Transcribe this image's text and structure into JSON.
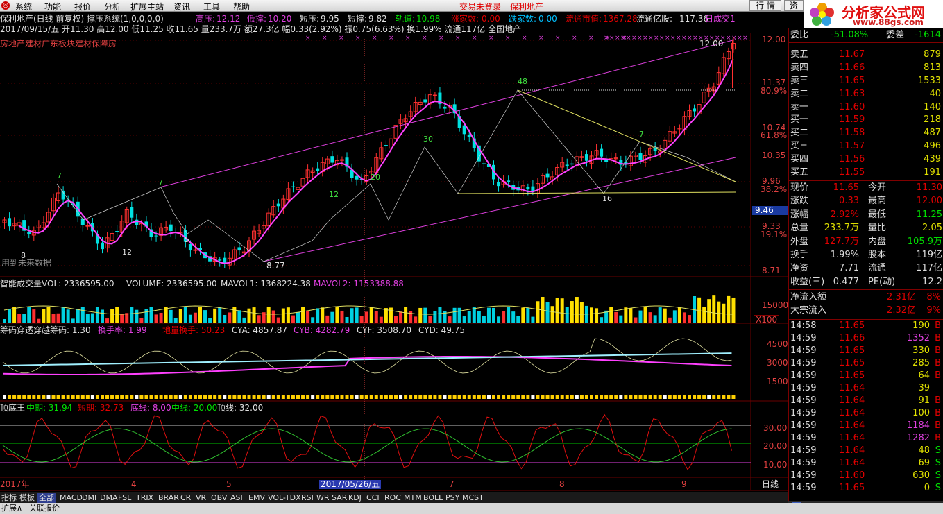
{
  "menu": {
    "items": [
      "系统",
      "功能",
      "报价",
      "分析",
      "扩展主站",
      "资讯",
      "工具",
      "帮助"
    ],
    "center_text": "交易未登录",
    "stock_name": "保利地产",
    "btn_trade": "行 情",
    "btn_news": "资"
  },
  "brand": {
    "title": "分析家公式网",
    "url": "www.88gs.com"
  },
  "header": {
    "line1_title": "保利地产(日线 前复权) 撑压系统(1,0,0,0,0)",
    "gaoya_label": "高压:",
    "gaoya": "12.12",
    "diya_label": "低撑:",
    "diya": "10.20",
    "duanya_label": "短压:",
    "duanya": "9.95",
    "duancheng_label": "短撑:",
    "duancheng": "9.82",
    "guidao_label": "轨道:",
    "guidao": "10.98",
    "zhang_label": "涨家数:",
    "zhang": "0.00",
    "die_label": "跌家数:",
    "die": "0.00",
    "ltsz_label": "流通市值:",
    "ltsz": "1367.28",
    "ltyg_label": "流通亿股:",
    "ltyg": "117.36",
    "rcj": "日成交1",
    "line2": "2017/09/15/五 开11.30 高12.00 低11.25 收11.65 量233.7万 额27.3亿 幅0.33(2.92%) 振0.75(6.63%) 换1.99% 流通117亿 全国地产",
    "line3": "房地产建材广东板块建材保障房",
    "future_note": "用到未来数据"
  },
  "price_axis": [
    "12.00",
    "11.37",
    "80.9%",
    "10.74",
    "61.8%",
    "10.35",
    "9.96",
    "38.2%",
    "9.46",
    "9.33",
    "19.1%",
    "8.71"
  ],
  "price_labels": {
    "top": "12.00",
    "low": "8.77",
    "peaks": [
      "7",
      "7",
      "12",
      "20",
      "30",
      "48",
      "7",
      "8",
      "12",
      "5",
      "16"
    ]
  },
  "volume": {
    "title": "智能成交量",
    "vol": "VOL: 2336595.00",
    "volume": "VOLUME: 2336595.00",
    "mavol1": "MAVOL1: 1368224.38",
    "mavol2": "MAVOL2: 1153388.88",
    "axis": [
      "15000",
      "X100"
    ]
  },
  "chip": {
    "title": "筹码穿透",
    "p1": "穿越筹码: 1.30",
    "p2": "换手率: 1.99",
    "p3": "地量换手: 50.23",
    "cya": "CYA: 4857.87",
    "cyb": "CYB: 4282.79",
    "cyf": "CYF: 3508.70",
    "cyd": "CYD: 49.75",
    "axis": [
      "4500",
      "3000",
      "1500"
    ]
  },
  "bottom": {
    "title": "顶底王",
    "mid": "中期: 31.94",
    "short": "短期: 32.73",
    "base": "底线: 8.00",
    "center": "中线: 20.00",
    "top": "顶线: 32.00",
    "axis": [
      "30.00",
      "20.00",
      "10.00"
    ]
  },
  "dates": [
    "2017年",
    "4",
    "5",
    "2017/05/26/五",
    "7",
    "8",
    "9",
    "日线"
  ],
  "tabs": [
    "指标",
    "模板",
    "全部",
    "MACD",
    "DMI",
    "DMA",
    "FSL",
    "TRIX",
    "BRAR",
    "CR",
    "VR",
    "OBV",
    "ASI",
    "EMV",
    "VOL-TDX",
    "RSI",
    "WR",
    "SAR",
    "KDJ",
    "CCI",
    "ROC",
    "MTM",
    "BOLL",
    "PSY",
    "MCST"
  ],
  "status": [
    "扩展∧",
    "关联报价"
  ],
  "quote": {
    "code_row": "600048 保利地产",
    "weibi_label": "委比",
    "weibi": "-51.08%",
    "weicha_label": "委差",
    "weicha": "-1614",
    "asks": [
      [
        "卖五",
        "11.67",
        "879"
      ],
      [
        "卖四",
        "11.66",
        "813"
      ],
      [
        "卖三",
        "11.65",
        "1533"
      ],
      [
        "卖二",
        "11.63",
        "40"
      ],
      [
        "卖一",
        "11.60",
        "140"
      ]
    ],
    "bids": [
      [
        "买一",
        "11.59",
        "218"
      ],
      [
        "买二",
        "11.58",
        "487"
      ],
      [
        "买三",
        "11.57",
        "496"
      ],
      [
        "买四",
        "11.56",
        "439"
      ],
      [
        "买五",
        "11.55",
        "191"
      ]
    ],
    "stats": [
      [
        "现价",
        "11.65",
        "今开",
        "11.30"
      ],
      [
        "涨跌",
        "0.33",
        "最高",
        "12.00"
      ],
      [
        "涨幅",
        "2.92%",
        "最低",
        "11.25"
      ],
      [
        "总量",
        "233.7万",
        "量比",
        "2.05"
      ],
      [
        "外盘",
        "127.7万",
        "内盘",
        "105.9万"
      ],
      [
        "换手",
        "1.99%",
        "股本",
        "119亿"
      ],
      [
        "净资",
        "7.71",
        "流通",
        "117亿"
      ],
      [
        "收益(三)",
        "0.477",
        "PE(动)",
        "12.2"
      ]
    ],
    "flows": [
      [
        "净流入额",
        "2.31亿",
        "8%"
      ],
      [
        "大宗流入",
        "2.32亿",
        "9%"
      ]
    ],
    "ticks": [
      [
        "14:58",
        "11.65",
        "190",
        "B"
      ],
      [
        "14:59",
        "11.66",
        "1352",
        "B"
      ],
      [
        "14:59",
        "11.65",
        "330",
        "B"
      ],
      [
        "14:59",
        "11.65",
        "285",
        "B"
      ],
      [
        "14:59",
        "11.65",
        "64",
        "B"
      ],
      [
        "14:59",
        "11.64",
        "39",
        ""
      ],
      [
        "14:59",
        "11.64",
        "91",
        "B"
      ],
      [
        "14:59",
        "11.64",
        "100",
        "B"
      ],
      [
        "14:59",
        "11.64",
        "1184",
        "B"
      ],
      [
        "14:59",
        "11.64",
        "1282",
        "B"
      ],
      [
        "14:59",
        "11.64",
        "48",
        "S"
      ],
      [
        "14:59",
        "11.64",
        "69",
        "S"
      ],
      [
        "14:59",
        "11.60",
        "630",
        "S"
      ],
      [
        "14:59",
        "11.65",
        "0",
        "S"
      ]
    ],
    "bottom_tabs": [
      "笔",
      "价",
      "细",
      "势",
      "值",
      "主",
      "筹"
    ]
  }
}
